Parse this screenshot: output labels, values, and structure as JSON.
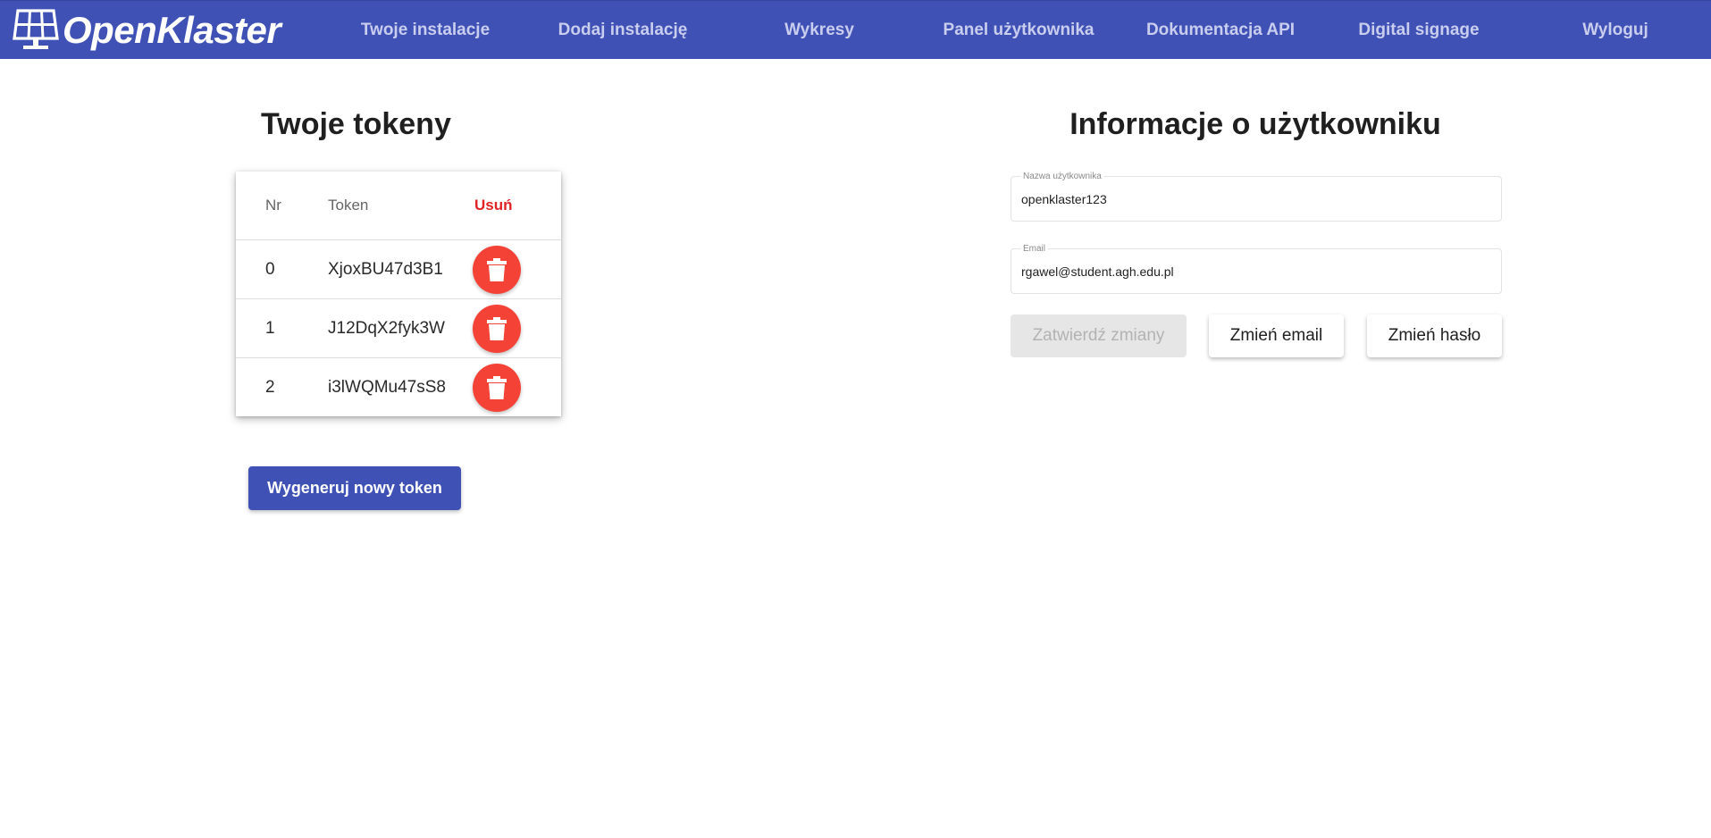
{
  "nav": {
    "logo_text": "OpenKlaster",
    "items": [
      "Twoje instalacje",
      "Dodaj instalację",
      "Wykresy",
      "Panel użytkownika",
      "Dokumentacja API",
      "Digital signage",
      "Wyloguj"
    ]
  },
  "tokens": {
    "title": "Twoje tokeny",
    "columns": {
      "nr": "Nr",
      "token": "Token",
      "delete": "Usuń"
    },
    "rows": [
      {
        "nr": "0",
        "token": "XjoxBU47d3B1"
      },
      {
        "nr": "1",
        "token": "J12DqX2fyk3W"
      },
      {
        "nr": "2",
        "token": "i3lWQMu47sS8"
      }
    ],
    "generate_label": "Wygeneruj nowy token"
  },
  "user": {
    "title": "Informacje o użytkowniku",
    "username_label": "Nazwa użytkownika",
    "username_value": "openklaster123",
    "email_label": "Email",
    "email_value": "rgawel@student.agh.edu.pl",
    "confirm_label": "Zatwierdź zmiany",
    "change_email_label": "Zmień email",
    "change_password_label": "Zmień hasło"
  },
  "colors": {
    "primary": "#3f51b5",
    "danger": "#f44336",
    "delete_header": "#e12323",
    "nav_text": "#c9cdee",
    "disabled_bg": "#e6e6e6"
  },
  "icons": {
    "logo": "solar-panel-icon",
    "delete": "trash-icon"
  }
}
